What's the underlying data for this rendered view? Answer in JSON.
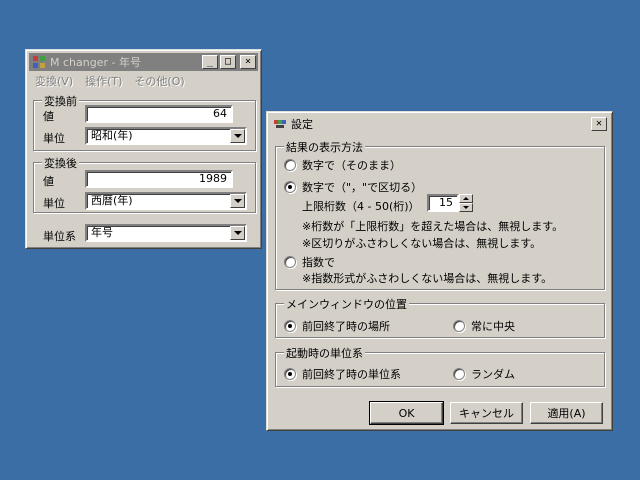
{
  "main_window": {
    "title": "M changer - 年号",
    "menu": [
      "変換(V)",
      "操作(T)",
      "その他(O)"
    ],
    "before": {
      "group_label": "変換前",
      "value_label": "値",
      "value": "64",
      "unit_label": "単位",
      "unit": "昭和(年)"
    },
    "after": {
      "group_label": "変換後",
      "value_label": "値",
      "value": "1989",
      "unit_label": "単位",
      "unit": "西暦(年)"
    },
    "unit_system_label": "単位系",
    "unit_system": "年号"
  },
  "settings_dialog": {
    "title": "設定",
    "close_glyph": "✕",
    "result_group": {
      "label": "結果の表示方法",
      "opt_plain": "数字で（そのまま）",
      "opt_separated": "数字で（\"，\"で区切る）",
      "digits_label": "上限桁数（4 - 50(桁)）",
      "digits_value": "15",
      "note1": "※桁数が「上限桁数」を超えた場合は、無視します。",
      "note2": "※区切りがふさわしくない場合は、無視します。",
      "opt_exponent": "指数で",
      "note3": "※指数形式がふさわしくない場合は、無視します。"
    },
    "window_pos_group": {
      "label": "メインウィンドウの位置",
      "opt_last": "前回終了時の場所",
      "opt_center": "常に中央"
    },
    "startup_group": {
      "label": "起動時の単位系",
      "opt_last": "前回終了時の単位系",
      "opt_random": "ランダム"
    },
    "buttons": {
      "ok": "OK",
      "cancel": "キャンセル",
      "apply": "適用(A)"
    }
  },
  "colors": {
    "desktop": "#3a6ea5",
    "face": "#d4d0c8",
    "inactive_title": "#808080"
  }
}
